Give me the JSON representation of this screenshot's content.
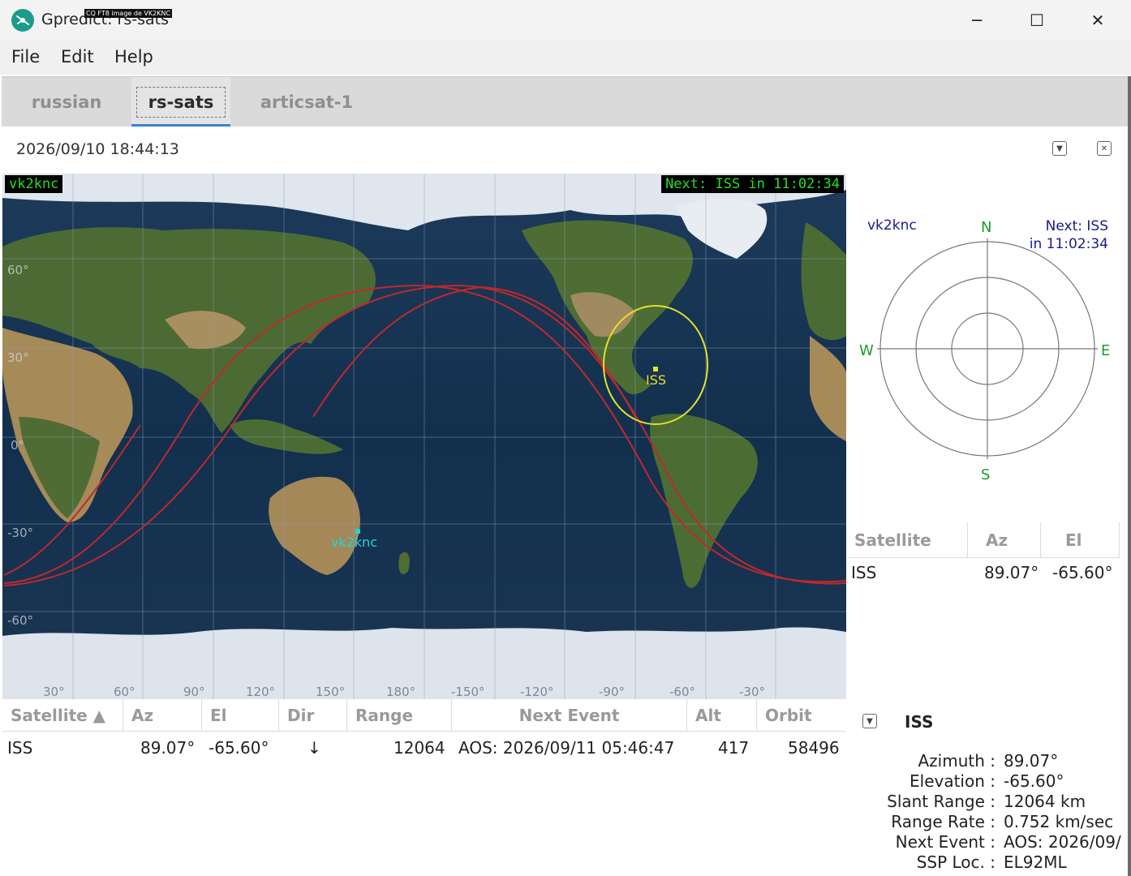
{
  "window": {
    "title": "Gpredict: rs-sats",
    "watermark": "CQ FT8 image de VK2KNC",
    "minimize": "─",
    "maximize": "☐",
    "close": "✕"
  },
  "menu": {
    "file": "File",
    "edit": "Edit",
    "help": "Help"
  },
  "tabs": [
    {
      "label": "russian"
    },
    {
      "label": "rs-sats"
    },
    {
      "label": "articsat-1"
    }
  ],
  "module": {
    "timestamp": "2026/09/10 18:44:13",
    "options_icon": "▼",
    "close_icon": "✕"
  },
  "map": {
    "qth_label": "vk2knc",
    "next_label": "Next: ISS in 11:02:34",
    "qth_marker_label": "vk2knc",
    "sat_marker_label": "ISS",
    "lat_labels": [
      "60°",
      "30°",
      "0°",
      "-30°",
      "-60°"
    ],
    "lon_labels": [
      "30°",
      "60°",
      "90°",
      "120°",
      "150°",
      "180°",
      "-150°",
      "-120°",
      "-90°",
      "-60°",
      "-30°"
    ]
  },
  "sat_table": {
    "headers": {
      "satellite": "Satellite ▲",
      "az": "Az",
      "el": "El",
      "dir": "Dir",
      "range": "Range",
      "next_event": "Next Event",
      "alt": "Alt",
      "orbit": "Orbit"
    },
    "row": {
      "satellite": "ISS",
      "az": "89.07°",
      "el": "-65.60°",
      "dir": "↓",
      "range": "12064",
      "next_event": "AOS: 2026/09/11 05:46:47",
      "alt": "417",
      "orbit": "58496"
    }
  },
  "polar": {
    "qth": "vk2knc",
    "next_line1": "Next: ISS",
    "next_line2": "in 11:02:34",
    "n": "N",
    "s": "S",
    "e": "E",
    "w": "W"
  },
  "mini_table": {
    "headers": {
      "satellite": "Satellite",
      "az": "Az",
      "el": "El"
    },
    "row": {
      "satellite": "ISS",
      "az": "89.07°",
      "el": "-65.60°"
    }
  },
  "detail": {
    "collapse_icon": "▼",
    "title": "ISS",
    "rows": [
      {
        "label": "Azimuth :",
        "value": "89.07°"
      },
      {
        "label": "Elevation :",
        "value": "-65.60°"
      },
      {
        "label": "Slant Range :",
        "value": "12064 km"
      },
      {
        "label": "Range Rate :",
        "value": "0.752 km/sec"
      },
      {
        "label": "Next Event :",
        "value": "AOS: 2026/09/"
      },
      {
        "label": "SSP Loc. :",
        "value": "EL92ML"
      }
    ]
  },
  "colors": {
    "map_green": "#22e022",
    "ground_track": "#c0282c",
    "footprint": "#e6e02a",
    "qth_cyan": "#22d4d4",
    "tab_accent": "#3a84d6"
  }
}
